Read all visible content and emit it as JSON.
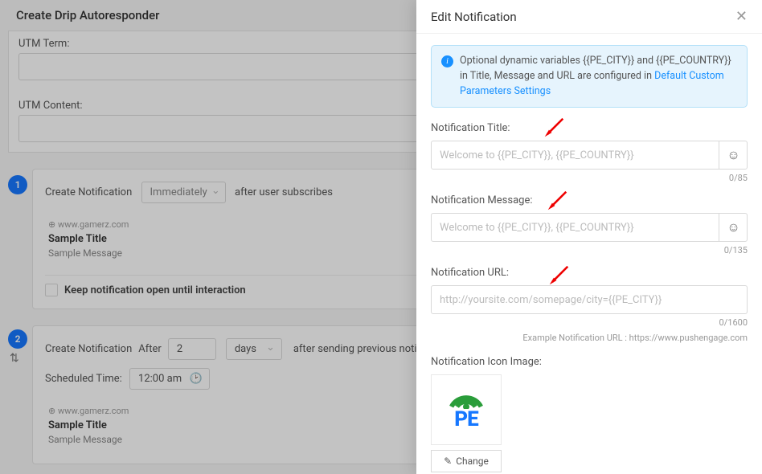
{
  "bgTitle": "Create Drip Autoresponder",
  "utmTermLabel": "UTM Term:",
  "utmContentLabel": "UTM Content:",
  "step1": {
    "num": "1",
    "create": "Create Notification",
    "immediately": "Immediately",
    "after": "after user subscribes",
    "globe": "⊕  www.gamerz.com",
    "title": "Sample Title",
    "msg": "Sample Message",
    "keep": "Keep notification open until interaction"
  },
  "step2": {
    "num": "2",
    "create": "Create Notification",
    "afterLabel": "After",
    "days": "2",
    "daysWord": "days",
    "afterText": "after sending previous notification",
    "schedLabel": "Scheduled Time:",
    "schedTime": "12:00 am",
    "globe": "⊕  www.gamerz.com",
    "title": "Sample Title",
    "msg": "Sample Message"
  },
  "panel": {
    "title": "Edit Notification",
    "info1": "Optional dynamic variables {{PE_CITY}} and {{PE_COUNTRY}} in Title, Message and URL are configured in ",
    "infoLink": "Default Custom Parameters Settings",
    "titleLabel": "Notification Title:",
    "titlePlaceholder": "Welcome to {{PE_CITY}}, {{PE_COUNTRY}}",
    "titleCounter": "0/85",
    "msgLabel": "Notification Message:",
    "msgPlaceholder": "Welcome to {{PE_CITY}}, {{PE_COUNTRY}}",
    "msgCounter": "0/135",
    "urlLabel": "Notification URL:",
    "urlPlaceholder": "http://yoursite.com/somepage/city={{PE_CITY}}",
    "urlCounter": "0/1600",
    "example": "Example Notification URL : https://www.pushengage.com",
    "iconLabel": "Notification Icon Image:",
    "change": "Change"
  }
}
